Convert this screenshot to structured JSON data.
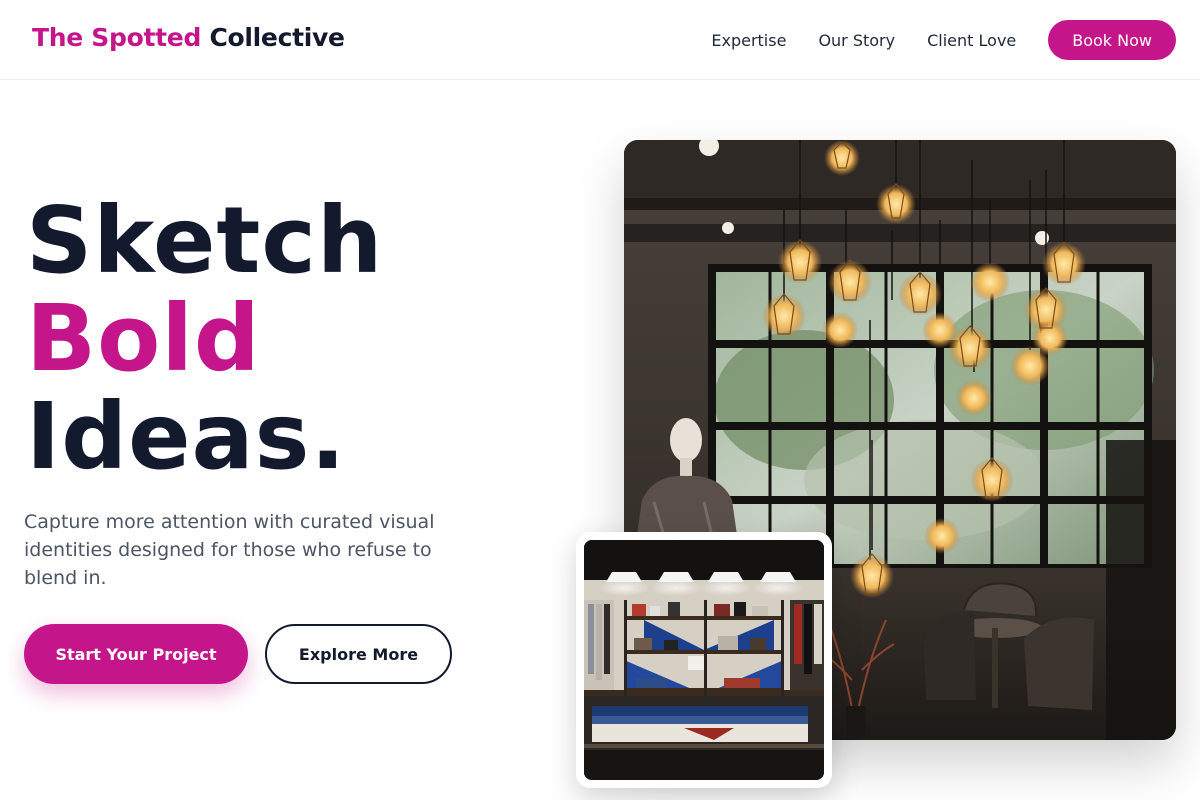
{
  "header": {
    "logo_accent": "The Spotted",
    "logo_rest": "Collective",
    "nav": [
      "Expertise",
      "Our Story",
      "Client Love"
    ],
    "book_label": "Book Now"
  },
  "hero": {
    "headline_line1": "Sketch",
    "headline_line2": "Bold",
    "headline_line3": "Ideas.",
    "subtext": "Capture more attention with curated visual identities designed for those who refuse to blend in.",
    "primary_cta": "Start Your Project",
    "secondary_cta": "Explore More"
  },
  "images": {
    "main": "cafe-interior-hanging-bulbs-photo",
    "inset": "clothing-boutique-shelves-photo"
  },
  "colors": {
    "accent": "#c4168a",
    "dark": "#131a2e",
    "body_text": "#4b5563"
  }
}
